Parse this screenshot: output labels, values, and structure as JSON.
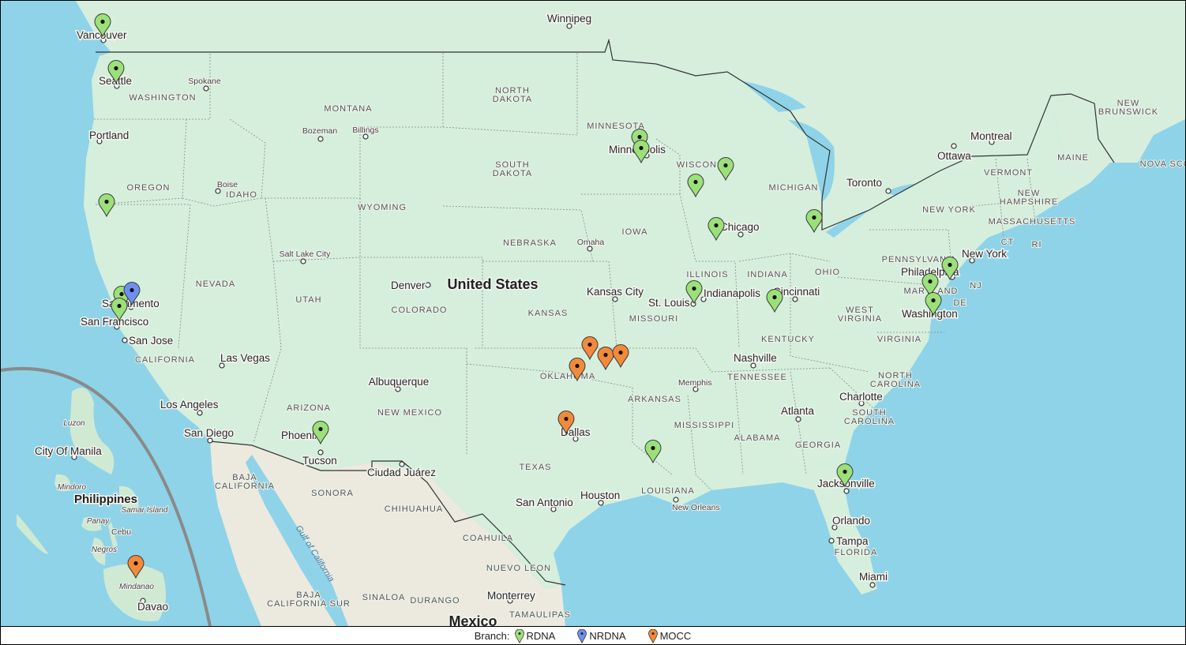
{
  "map": {
    "country_labels": [
      {
        "id": "usa",
        "text": "United States"
      },
      {
        "id": "mexico",
        "text": "Mexico"
      },
      {
        "id": "philippines",
        "text": "Philippines"
      }
    ],
    "city_labels": [
      {
        "id": "winnipeg",
        "text": "Winnipeg"
      },
      {
        "id": "vancouver",
        "text": "Vancouver"
      },
      {
        "id": "seattle",
        "text": "Seattle"
      },
      {
        "id": "spokane",
        "text": "Spokane"
      },
      {
        "id": "portland",
        "text": "Portland"
      },
      {
        "id": "bozeman",
        "text": "Bozeman"
      },
      {
        "id": "billings",
        "text": "Billings"
      },
      {
        "id": "boise",
        "text": "Boise"
      },
      {
        "id": "salt-lake-city",
        "text": "Salt Lake City"
      },
      {
        "id": "sacramento",
        "text": "Sacramento"
      },
      {
        "id": "san-francisco",
        "text": "San Francisco"
      },
      {
        "id": "san-jose",
        "text": "San Jose"
      },
      {
        "id": "las-vegas",
        "text": "Las Vegas"
      },
      {
        "id": "los-angeles",
        "text": "Los Angeles"
      },
      {
        "id": "san-diego",
        "text": "San Diego"
      },
      {
        "id": "phoenix",
        "text": "Phoenix"
      },
      {
        "id": "tucson",
        "text": "Tucson"
      },
      {
        "id": "albuquerque",
        "text": "Albuquerque"
      },
      {
        "id": "ciudad-juarez",
        "text": "Ciudad Juárez"
      },
      {
        "id": "denver",
        "text": "Denver"
      },
      {
        "id": "omaha",
        "text": "Omaha"
      },
      {
        "id": "kansas-city",
        "text": "Kansas City"
      },
      {
        "id": "minneapolis",
        "text": "Minneapolis"
      },
      {
        "id": "chicago",
        "text": "Chicago"
      },
      {
        "id": "st-louis",
        "text": "St. Louis"
      },
      {
        "id": "indianapolis",
        "text": "Indianapolis"
      },
      {
        "id": "cincinnati",
        "text": "Cincinnati"
      },
      {
        "id": "nashville",
        "text": "Nashville"
      },
      {
        "id": "memphis",
        "text": "Memphis"
      },
      {
        "id": "dallas",
        "text": "Dallas"
      },
      {
        "id": "san-antonio",
        "text": "San Antonio"
      },
      {
        "id": "houston",
        "text": "Houston"
      },
      {
        "id": "new-orleans",
        "text": "New Orleans"
      },
      {
        "id": "atlanta",
        "text": "Atlanta"
      },
      {
        "id": "charlotte",
        "text": "Charlotte"
      },
      {
        "id": "jacksonville",
        "text": "Jacksonville"
      },
      {
        "id": "orlando",
        "text": "Orlando"
      },
      {
        "id": "tampa",
        "text": "Tampa"
      },
      {
        "id": "miami",
        "text": "Miami"
      },
      {
        "id": "washington",
        "text": "Washington"
      },
      {
        "id": "philadelphia",
        "text": "Philadelphia"
      },
      {
        "id": "new-york",
        "text": "New York"
      },
      {
        "id": "toronto",
        "text": "Toronto"
      },
      {
        "id": "ottawa",
        "text": "Ottawa"
      },
      {
        "id": "montreal",
        "text": "Montreal"
      },
      {
        "id": "monterrey",
        "text": "Monterrey"
      },
      {
        "id": "city-of-manila",
        "text": "City Of Manila"
      },
      {
        "id": "davao",
        "text": "Davao"
      },
      {
        "id": "cebu",
        "text": "Cebu"
      }
    ],
    "region_labels": [
      {
        "id": "washington-state",
        "text": "WASHINGTON"
      },
      {
        "id": "oregon",
        "text": "OREGON"
      },
      {
        "id": "idaho",
        "text": "IDAHO"
      },
      {
        "id": "montana",
        "text": "MONTANA"
      },
      {
        "id": "wyoming",
        "text": "WYOMING"
      },
      {
        "id": "nevada",
        "text": "NEVADA"
      },
      {
        "id": "utah",
        "text": "UTAH"
      },
      {
        "id": "colorado",
        "text": "COLORADO"
      },
      {
        "id": "california",
        "text": "CALIFORNIA"
      },
      {
        "id": "arizona",
        "text": "ARIZONA"
      },
      {
        "id": "new-mexico",
        "text": "NEW MEXICO"
      },
      {
        "id": "north-dakota-1",
        "text": "NORTH"
      },
      {
        "id": "north-dakota-2",
        "text": "DAKOTA"
      },
      {
        "id": "south-dakota-1",
        "text": "SOUTH"
      },
      {
        "id": "south-dakota-2",
        "text": "DAKOTA"
      },
      {
        "id": "nebraska",
        "text": "NEBRASKA"
      },
      {
        "id": "kansas",
        "text": "KANSAS"
      },
      {
        "id": "oklahoma",
        "text": "OKLAHOMA"
      },
      {
        "id": "texas",
        "text": "TEXAS"
      },
      {
        "id": "minnesota",
        "text": "MINNESOTA"
      },
      {
        "id": "iowa",
        "text": "IOWA"
      },
      {
        "id": "missouri",
        "text": "MISSOURI"
      },
      {
        "id": "arkansas",
        "text": "ARKANSAS"
      },
      {
        "id": "louisiana",
        "text": "LOUISIANA"
      },
      {
        "id": "wisconsin",
        "text": "WISCONSIN"
      },
      {
        "id": "illinois",
        "text": "ILLINOIS"
      },
      {
        "id": "michigan",
        "text": "MICHIGAN"
      },
      {
        "id": "indiana",
        "text": "INDIANA"
      },
      {
        "id": "ohio",
        "text": "OHIO"
      },
      {
        "id": "kentucky",
        "text": "KENTUCKY"
      },
      {
        "id": "tennessee",
        "text": "TENNESSEE"
      },
      {
        "id": "mississippi",
        "text": "MISSISSIPPI"
      },
      {
        "id": "alabama",
        "text": "ALABAMA"
      },
      {
        "id": "georgia",
        "text": "GEORGIA"
      },
      {
        "id": "florida",
        "text": "FLORIDA"
      },
      {
        "id": "south-carolina-1",
        "text": "SOUTH"
      },
      {
        "id": "south-carolina-2",
        "text": "CAROLINA"
      },
      {
        "id": "north-carolina-1",
        "text": "NORTH"
      },
      {
        "id": "north-carolina-2",
        "text": "CAROLINA"
      },
      {
        "id": "virginia",
        "text": "VIRGINIA"
      },
      {
        "id": "west-virginia-1",
        "text": "WEST"
      },
      {
        "id": "west-virginia-2",
        "text": "VIRGINIA"
      },
      {
        "id": "pennsylvania",
        "text": "PENNSYLVANIA"
      },
      {
        "id": "new-york-state",
        "text": "NEW YORK"
      },
      {
        "id": "maryland",
        "text": "MARYLAND"
      },
      {
        "id": "new-jersey",
        "text": "NJ"
      },
      {
        "id": "delaware",
        "text": "DE"
      },
      {
        "id": "connecticut",
        "text": "CT"
      },
      {
        "id": "rhode-island",
        "text": "RI"
      },
      {
        "id": "massachusetts",
        "text": "MASSACHUSETTS"
      },
      {
        "id": "vermont",
        "text": "VERMONT"
      },
      {
        "id": "new-hampshire-1",
        "text": "NEW"
      },
      {
        "id": "new-hampshire-2",
        "text": "HAMPSHIRE"
      },
      {
        "id": "maine",
        "text": "MAINE"
      },
      {
        "id": "new-brunswick-1",
        "text": "NEW"
      },
      {
        "id": "new-brunswick-2",
        "text": "BRUNSWICK"
      },
      {
        "id": "nova-scotia",
        "text": "NOVA SCO"
      },
      {
        "id": "baja-california-1",
        "text": "BAJA"
      },
      {
        "id": "baja-california-2",
        "text": "CALIFORNIA"
      },
      {
        "id": "baja-california-sur-1",
        "text": "BAJA"
      },
      {
        "id": "baja-california-sur-2",
        "text": "CALIFORNIA SUR"
      },
      {
        "id": "sonora",
        "text": "SONORA"
      },
      {
        "id": "chihuahua",
        "text": "CHIHUAHUA"
      },
      {
        "id": "coahuila",
        "text": "COAHUILA"
      },
      {
        "id": "nuevo-leon",
        "text": "NUEVO LEON"
      },
      {
        "id": "sinaloa",
        "text": "SINALOA"
      },
      {
        "id": "durango",
        "text": "DURANGO"
      },
      {
        "id": "tamaulipas",
        "text": "TAMAULIPAS"
      },
      {
        "id": "luzon",
        "text": "Luzon"
      },
      {
        "id": "mindoro",
        "text": "Mindoro"
      },
      {
        "id": "panay",
        "text": "Panay"
      },
      {
        "id": "samar",
        "text": "Samar Island"
      },
      {
        "id": "negros",
        "text": "Negros"
      },
      {
        "id": "mindanao",
        "text": "Mindanao"
      },
      {
        "id": "gulf-of-california",
        "text": "Gulf of California"
      }
    ],
    "markers": [
      {
        "id": "vancouver",
        "branch": "RDNA"
      },
      {
        "id": "seattle",
        "branch": "RDNA"
      },
      {
        "id": "southern-oregon",
        "branch": "RDNA"
      },
      {
        "id": "sacramento-rdna",
        "branch": "RDNA"
      },
      {
        "id": "sacramento-nrdna",
        "branch": "NRDNA"
      },
      {
        "id": "bay-area",
        "branch": "RDNA"
      },
      {
        "id": "phoenix",
        "branch": "RDNA"
      },
      {
        "id": "minneapolis-1",
        "branch": "RDNA"
      },
      {
        "id": "minneapolis-2",
        "branch": "RDNA"
      },
      {
        "id": "wisconsin",
        "branch": "RDNA"
      },
      {
        "id": "southern-wisconsin",
        "branch": "RDNA"
      },
      {
        "id": "chicago-area",
        "branch": "RDNA"
      },
      {
        "id": "detroit",
        "branch": "RDNA"
      },
      {
        "id": "st-louis",
        "branch": "RDNA"
      },
      {
        "id": "cincinnati-area",
        "branch": "RDNA"
      },
      {
        "id": "philadelphia",
        "branch": "RDNA"
      },
      {
        "id": "baltimore",
        "branch": "RDNA"
      },
      {
        "id": "washington-dc",
        "branch": "RDNA"
      },
      {
        "id": "jackson-ms",
        "branch": "RDNA"
      },
      {
        "id": "jacksonville",
        "branch": "RDNA"
      },
      {
        "id": "oklahoma-1",
        "branch": "MOCC"
      },
      {
        "id": "oklahoma-2",
        "branch": "MOCC"
      },
      {
        "id": "oklahoma-3",
        "branch": "MOCC"
      },
      {
        "id": "oklahoma-4",
        "branch": "MOCC"
      },
      {
        "id": "dallas",
        "branch": "MOCC"
      },
      {
        "id": "mindanao",
        "branch": "MOCC"
      }
    ]
  },
  "legend": {
    "title": "Branch:",
    "items": [
      {
        "label": "RDNA",
        "color": "#9ce07a"
      },
      {
        "label": "NRDNA",
        "color": "#6f8ff0"
      },
      {
        "label": "MOCC",
        "color": "#f28a3a"
      }
    ]
  },
  "colors": {
    "ocean": "#8fd3e8",
    "land_us": "#d5efdc",
    "land_canada": "#d7eedd",
    "land_mexico": "#ece9df",
    "philippines_land": "#cfe9d2"
  }
}
